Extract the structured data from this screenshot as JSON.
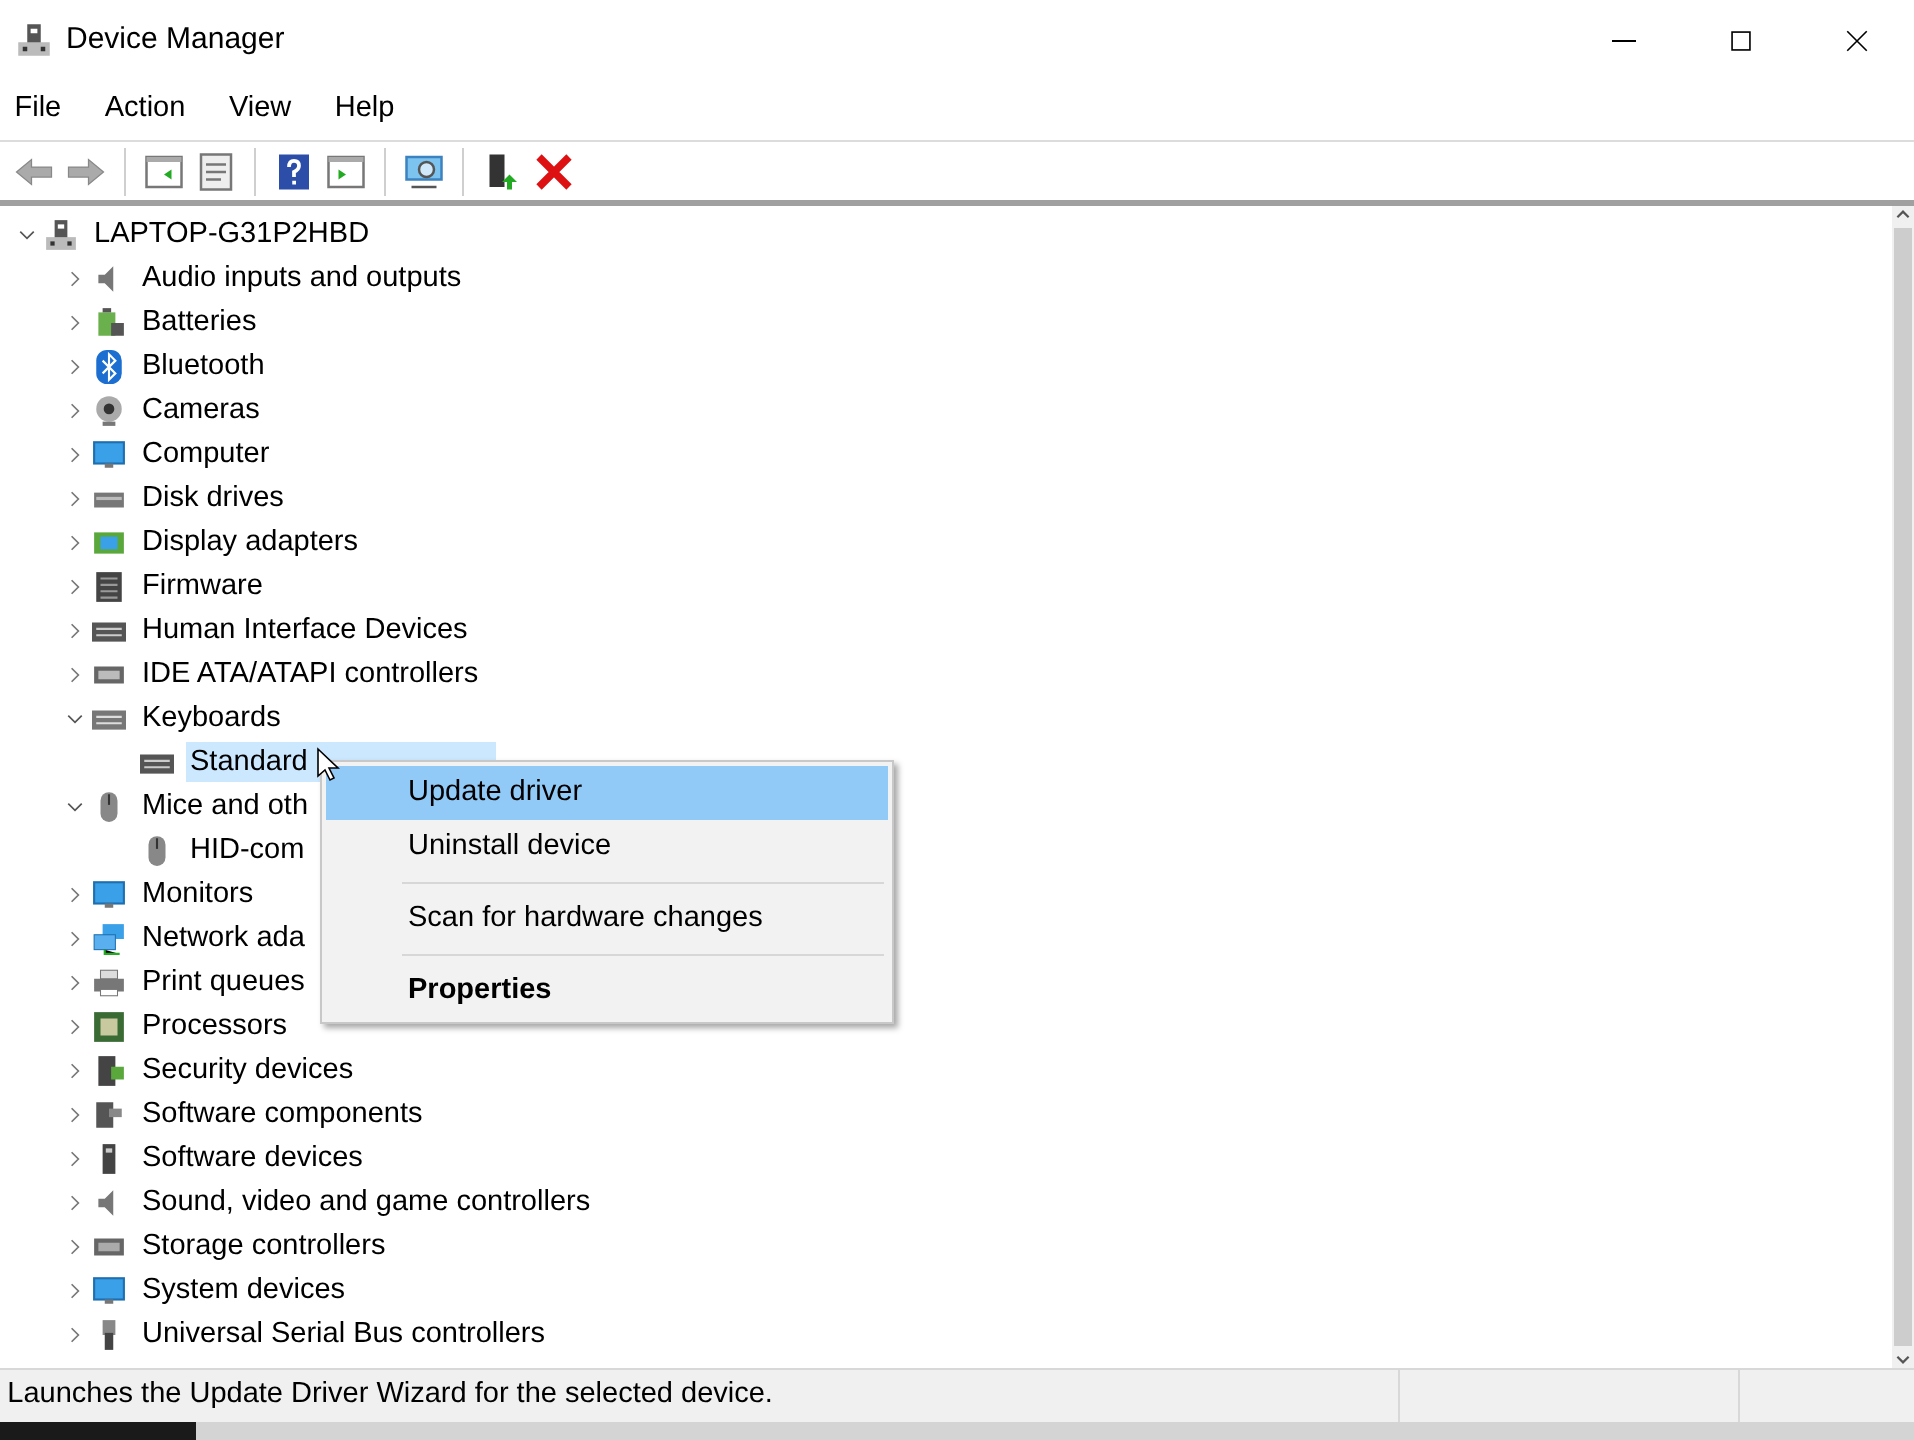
{
  "window": {
    "title": "Device Manager"
  },
  "menu_bar": [
    {
      "label": "File"
    },
    {
      "label": "Action"
    },
    {
      "label": "View"
    },
    {
      "label": "Help"
    }
  ],
  "tree": {
    "label": "LAPTOP-G31P2HBD",
    "expanded": true,
    "selected": false,
    "children": [
      {
        "label": "Audio inputs and outputs",
        "expanded": false,
        "selected": false
      },
      {
        "label": "Batteries",
        "expanded": false,
        "selected": false
      },
      {
        "label": "Bluetooth",
        "expanded": false,
        "selected": false
      },
      {
        "label": "Cameras",
        "expanded": false,
        "selected": false
      },
      {
        "label": "Computer",
        "expanded": false,
        "selected": false
      },
      {
        "label": "Disk drives",
        "expanded": false,
        "selected": false
      },
      {
        "label": "Display adapters",
        "expanded": false,
        "selected": false
      },
      {
        "label": "Firmware",
        "expanded": false,
        "selected": false
      },
      {
        "label": "Human Interface Devices",
        "expanded": false,
        "selected": false
      },
      {
        "label": "IDE ATA/ATAPI controllers",
        "expanded": false,
        "selected": false
      },
      {
        "label": "Keyboards",
        "expanded": true,
        "selected": false,
        "children": [
          {
            "label": "Standard",
            "selected": true
          }
        ]
      },
      {
        "label": "Mice and oth",
        "expanded": true,
        "selected": false,
        "children": [
          {
            "label": "HID-com",
            "selected": false
          }
        ]
      },
      {
        "label": "Monitors",
        "expanded": false,
        "selected": false
      },
      {
        "label": "Network ada",
        "expanded": false,
        "selected": false
      },
      {
        "label": "Print queues",
        "expanded": false,
        "selected": false
      },
      {
        "label": "Processors",
        "expanded": false,
        "selected": false
      },
      {
        "label": "Security devices",
        "expanded": false,
        "selected": false
      },
      {
        "label": "Software components",
        "expanded": false,
        "selected": false
      },
      {
        "label": "Software devices",
        "expanded": false,
        "selected": false
      },
      {
        "label": "Sound, video and game controllers",
        "expanded": false,
        "selected": false
      },
      {
        "label": "Storage controllers",
        "expanded": false,
        "selected": false
      },
      {
        "label": "System devices",
        "expanded": false,
        "selected": false
      },
      {
        "label": "Universal Serial Bus controllers",
        "expanded": false,
        "selected": false
      }
    ]
  },
  "context_menu": {
    "items": [
      {
        "kind": "item",
        "label": "Update driver",
        "selected": true,
        "default": false
      },
      {
        "kind": "item",
        "label": "Uninstall device",
        "selected": false,
        "default": false
      },
      {
        "kind": "separator"
      },
      {
        "kind": "item",
        "label": "Scan for hardware changes",
        "selected": false,
        "default": false
      },
      {
        "kind": "separator"
      },
      {
        "kind": "item",
        "label": "Properties",
        "selected": false,
        "default": true
      }
    ]
  },
  "status_bar": {
    "text": "Launches the Update Driver Wizard for the selected device."
  }
}
